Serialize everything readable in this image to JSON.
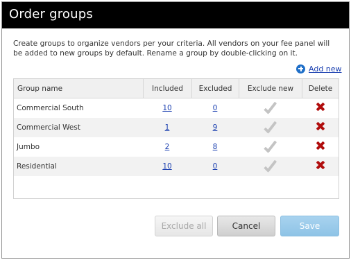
{
  "dialog": {
    "title": "Order groups",
    "description": "Create groups to organize vendors per your criteria. All vendors on your fee panel will be added to new groups by default. Rename a group by double-clicking on it.",
    "add_new_label": "Add new"
  },
  "table": {
    "headers": [
      "Group name",
      "Included",
      "Excluded",
      "Exclude new",
      "Delete"
    ],
    "rows": [
      {
        "name": "Commercial South",
        "included": "10",
        "excluded": "0"
      },
      {
        "name": "Commercial West",
        "included": "1",
        "excluded": "9"
      },
      {
        "name": "Jumbo",
        "included": "2",
        "excluded": "8"
      },
      {
        "name": "Residential",
        "included": "10",
        "excluded": "0"
      }
    ]
  },
  "buttons": {
    "exclude_all": "Exclude all",
    "cancel": "Cancel",
    "save": "Save"
  },
  "icons": {
    "add": "plus-circle-icon",
    "exclude_new": "checkmark-icon",
    "delete": "x-icon"
  },
  "colors": {
    "title_bar": "#000000",
    "link": "#1a3fb0",
    "delete": "#b00d0d",
    "save_button": "#9ccbea"
  }
}
